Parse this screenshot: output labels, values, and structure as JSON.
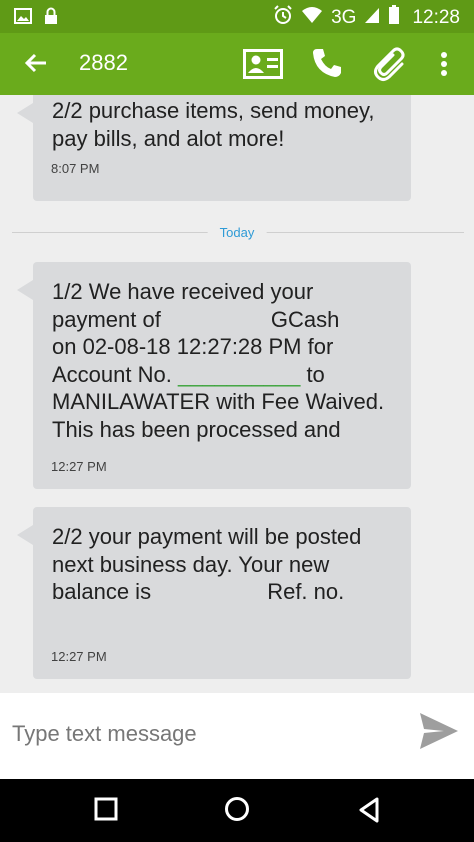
{
  "status_bar": {
    "network": "3G",
    "time": "12:28",
    "icons": [
      "image-icon",
      "lock-icon",
      "alarm-icon",
      "wifi-icon",
      "signal-icon",
      "battery-icon"
    ]
  },
  "app_bar": {
    "title": "2882",
    "icons": [
      "back-arrow-icon",
      "contact-card-icon",
      "phone-icon",
      "paperclip-icon",
      "more-vert-icon"
    ]
  },
  "divider": {
    "label": "Today"
  },
  "messages": [
    {
      "text": "2/2 purchase items, send money,\npay bills, and alot more!",
      "time": "8:07 PM"
    },
    {
      "text": "1/2 We have received your\npayment of                  GCash\non 02-08-18 12:27:28 PM for\nAccount No.",
      "text_blank": "__________",
      "text_cont": " to\nMANILAWATER with Fee Waived.\nThis has been processed and",
      "time": "12:27 PM"
    },
    {
      "text": "2/2 your payment will be posted\nnext business day. Your new\nbalance is                   Ref. no.",
      "time": "12:27 PM"
    }
  ],
  "composer": {
    "placeholder": "Type text message"
  },
  "nav_bar": {
    "icons": [
      "recents-square-icon",
      "home-circle-icon",
      "back-triangle-icon"
    ]
  },
  "colors": {
    "status_bar": "#5f9a16",
    "app_bar": "#6aab1c",
    "bubble": "#d9dadc",
    "divider_label": "#2f9bd6",
    "background": "#eeeeee"
  }
}
